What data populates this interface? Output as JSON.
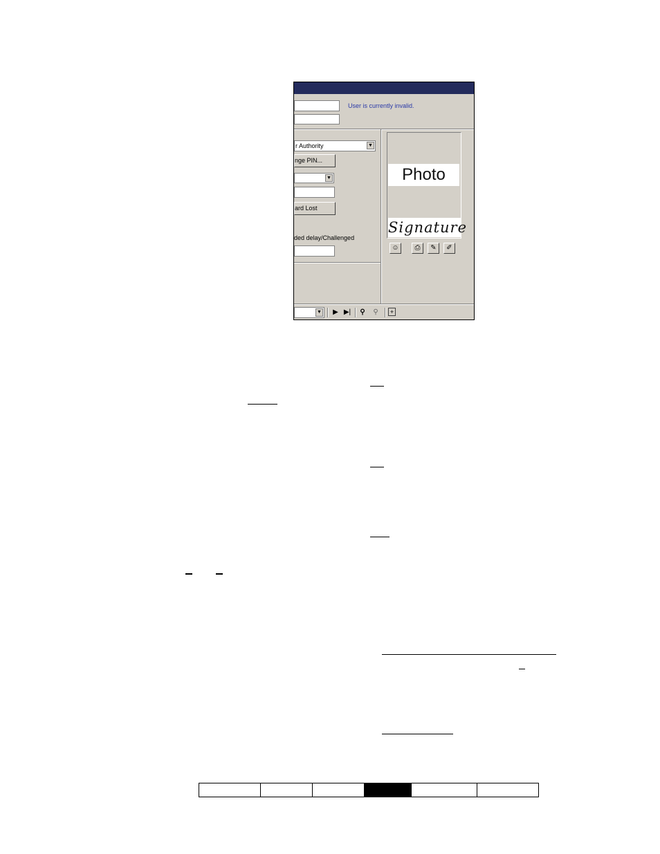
{
  "dialog": {
    "status_message": "User is currently invalid.",
    "authority_dropdown_value": "r Authority",
    "change_pin_label": "nge PIN...",
    "card_lost_label": "ard Lost",
    "delay_label": "ded delay/Challenged",
    "photo_placeholder": "Photo",
    "signature_placeholder": "Signature",
    "dropdown_arrow": "▼",
    "toolbar": {
      "next_glyph": "▶",
      "last_glyph": "▶|",
      "find_glyph": "⚲",
      "find_next_glyph": "⚲",
      "new_glyph": "+"
    },
    "icons": {
      "photo_tool": "person-icon",
      "print_tool": "printer-icon",
      "sign_tool": "pen-icon",
      "edit_tool": "edit-icon",
      "find": "binoculars-icon",
      "find_next": "binoculars-icon",
      "new_record": "new-document-icon"
    }
  },
  "footer_nav": {
    "cells": [
      {
        "active": false
      },
      {
        "active": false
      },
      {
        "active": false
      },
      {
        "active": true
      },
      {
        "active": false
      },
      {
        "active": false
      }
    ]
  },
  "colors": {
    "title_bar": "#232b5c",
    "dialog_face": "#d4d0c8",
    "status_text": "#2b3aa8",
    "active_cell": "#000000"
  }
}
